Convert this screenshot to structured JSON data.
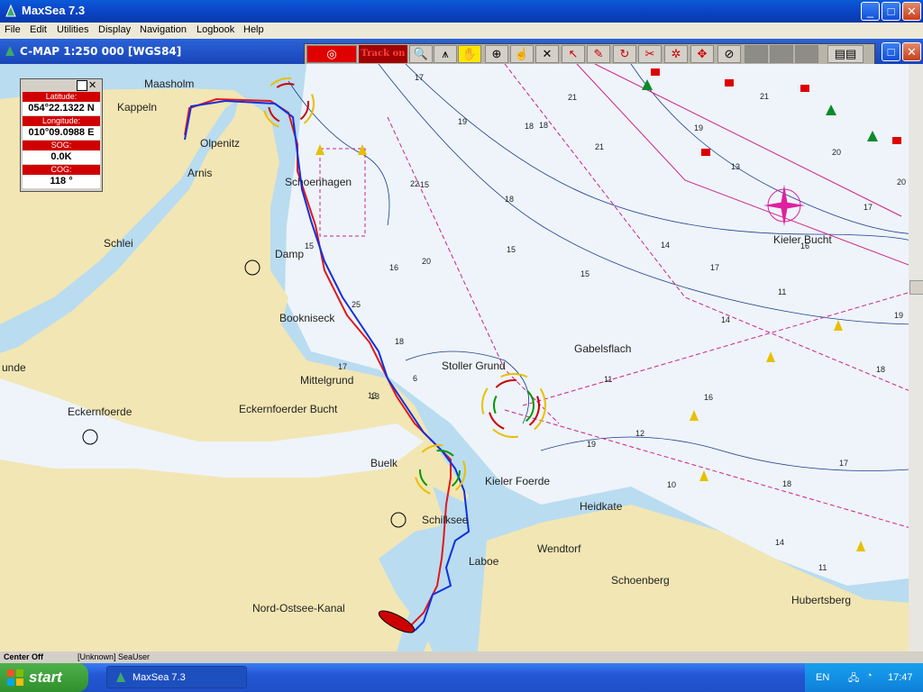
{
  "window": {
    "title": "MaxSea 7.3"
  },
  "menu": [
    "File",
    "Edit",
    "Utilities",
    "Display",
    "Navigation",
    "Logbook",
    "Help"
  ],
  "child_window": {
    "title": "C-MAP  1:250 000 [WGS84]"
  },
  "toolbar": {
    "track_label": "Track on"
  },
  "info": {
    "lat_label": "Latitude:",
    "lat": "054°22.1322 N",
    "lon_label": "Longitude:",
    "lon": "010°09.0988 E",
    "sog_label": "SOG:",
    "sog": "0.0K",
    "cog_label": "COG:",
    "cog": "118 °"
  },
  "places": [
    "Maasholm",
    "Kappeln",
    "Olpenitz",
    "Arnis",
    "Schlei",
    "Schoenhagen",
    "Damp",
    "Bookniseck",
    "Mittelgrund",
    "Eckernfoerder Bucht",
    "Eckernfoerde",
    "unde",
    "Stoller Grund",
    "Gabelsflach",
    "Kieler Bucht",
    "Buelk",
    "Kieler Foerde",
    "Heidkate",
    "Schilksee",
    "Wendtorf",
    "Laboe",
    "Schoenberg",
    "Nord-Ostsee-Kanal",
    "Hubertsberg"
  ],
  "depths": [
    "21",
    "19",
    "18",
    "21",
    "17",
    "21",
    "18",
    "15",
    "20",
    "15",
    "16",
    "17",
    "17",
    "14",
    "11",
    "13",
    "25",
    "18",
    "13",
    "19",
    "17",
    "14",
    "15",
    "18",
    "11",
    "16",
    "19",
    "10",
    "13",
    "12",
    "20",
    "11",
    "6",
    "17",
    "15",
    "16",
    "14",
    "19",
    "18",
    "22",
    "20",
    "18"
  ],
  "status": {
    "left": "Center Off",
    "mid": "[Unknown] SeaUser"
  },
  "taskbar": {
    "start": "start",
    "item": "MaxSea 7.3",
    "lang": "EN",
    "time": "17:47"
  },
  "colors": {
    "land": "#f2e6b4",
    "shallow": "#b9dcf0",
    "water": "#eef4fa",
    "route_red": "#e21818",
    "route_blue": "#1030e0"
  }
}
